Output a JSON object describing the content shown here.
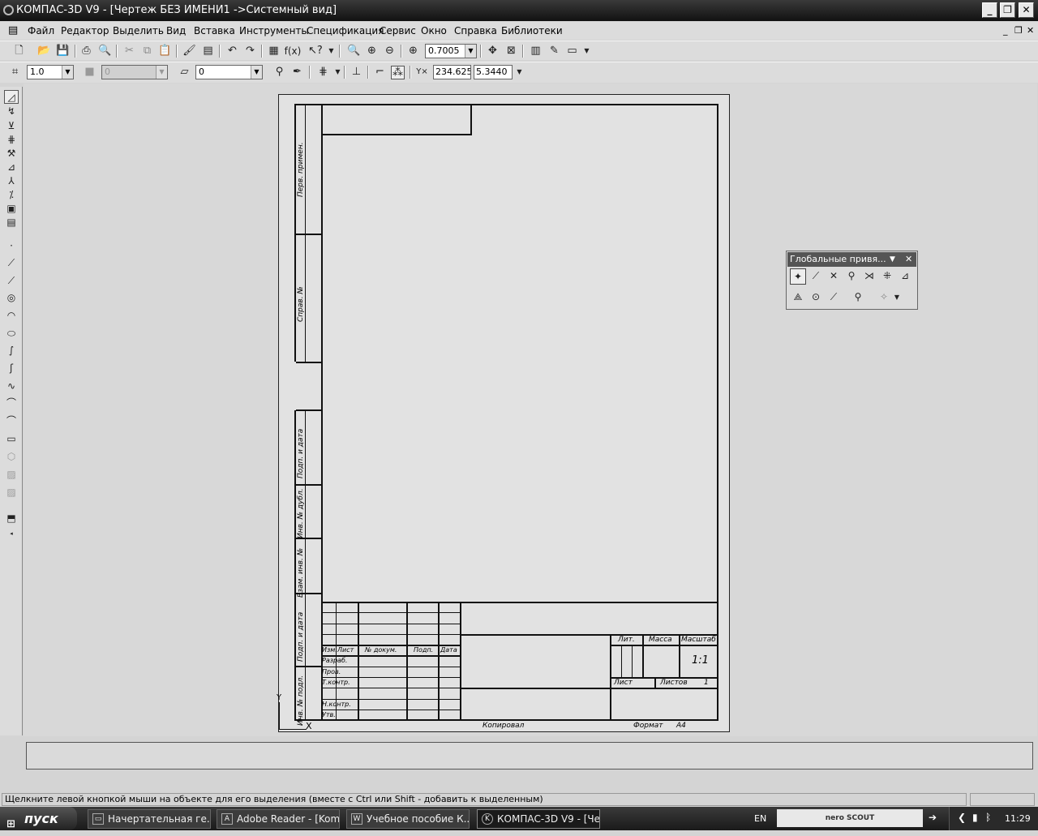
{
  "window": {
    "title": "КОМПАС-3D V9 - [Чертеж БЕЗ ИМЕНИ1 ->Системный вид]"
  },
  "menu": {
    "items": [
      "Файл",
      "Редактор",
      "Выделить",
      "Вид",
      "Вставка",
      "Инструменты",
      "Спецификация",
      "Сервис",
      "Окно",
      "Справка",
      "Библиотеки"
    ]
  },
  "toolbar1": {
    "zoom_value": "0.7005"
  },
  "toolbar2": {
    "step_value": "1.0",
    "style_value": "0",
    "layer_value": "0",
    "coord_x": "234.625",
    "coord_y": "5.3440",
    "coord_icon_label": "Y"
  },
  "drawing": {
    "side_labels": [
      "Перв. примен.",
      "Справ. №",
      "Подп. и дата",
      "Инв. № дубл.",
      "Взам. инв. №",
      "Подп. и дата",
      "Инв. № подл."
    ],
    "tb_rows": [
      "Изм.",
      "Лист",
      "№ докум.",
      "Подп.",
      "Дата"
    ],
    "tb_roles": [
      "Разраб.",
      "Пров.",
      "Т.контр.",
      "Н.контр.",
      "Утв."
    ],
    "tb_right": {
      "lit": "Лит.",
      "mass": "Масса",
      "scale": "Масштаб",
      "scale_value": "1:1",
      "sheet": "Лист",
      "sheets": "Листов",
      "sheets_value": "1"
    },
    "footer_copied": "Копировал",
    "footer_format": "Формат",
    "footer_format_value": "А4",
    "axis_y": "Y",
    "axis_x": "X"
  },
  "snap_panel": {
    "title": "Глобальные привя..."
  },
  "status": {
    "hint": "Щелкните левой кнопкой мыши на объекте для его выделения (вместе с Ctrl или Shift - добавить к выделенным)"
  },
  "taskbar": {
    "start": "пуск",
    "tasks": [
      "Начертательная ге...",
      "Adobe Reader - [Kom...",
      "Учебное пособие К...",
      "КОМПАС-3D V9 - [Че..."
    ],
    "lang": "EN",
    "nero": "nero SCOUT",
    "time": "11:29"
  }
}
